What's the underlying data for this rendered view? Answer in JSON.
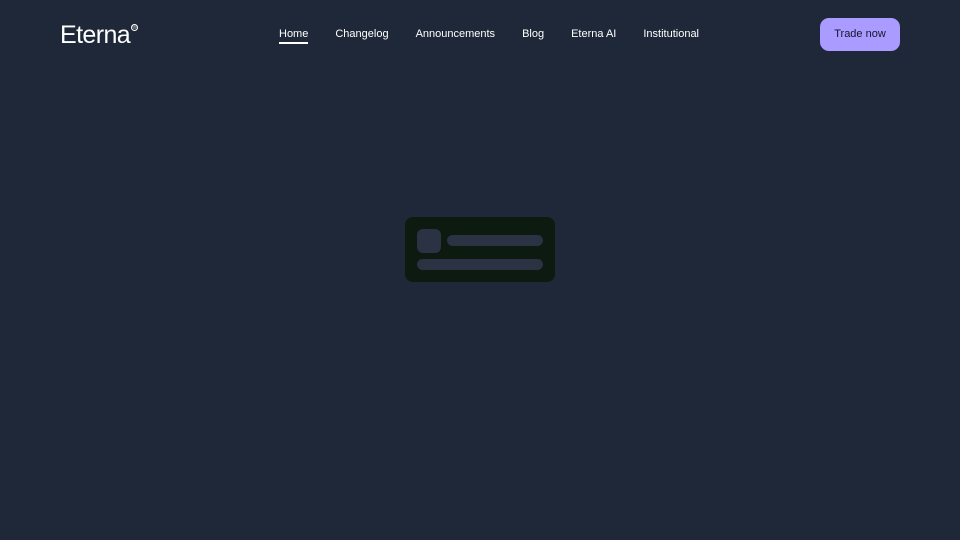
{
  "header": {
    "logo": {
      "text": "Eterna",
      "registered_mark": "®"
    },
    "nav": {
      "items": [
        {
          "label": "Home",
          "active": true
        },
        {
          "label": "Changelog",
          "active": false
        },
        {
          "label": "Announcements",
          "active": false
        },
        {
          "label": "Blog",
          "active": false
        },
        {
          "label": "Eterna AI",
          "active": false
        },
        {
          "label": "Institutional",
          "active": false
        }
      ]
    },
    "cta": {
      "label": "Trade now"
    }
  },
  "main": {
    "state": "loading-placeholder"
  },
  "colors": {
    "background": "#1f2838",
    "accent": "#a99bff",
    "placeholder_card": "#0c1a10",
    "placeholder_bar": "#2a3243"
  }
}
